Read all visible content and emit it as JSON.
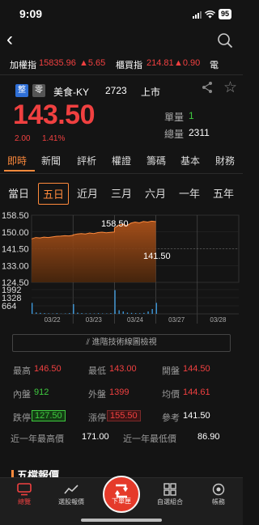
{
  "status": {
    "time": "9:09",
    "battery": "95"
  },
  "ticker": {
    "twse_label": "加權指",
    "twse_value": "15835.96",
    "twse_change": "▲5.65",
    "otc_label": "櫃買指",
    "otc_value": "214.81",
    "otc_change": "▲0.90",
    "more_label": "電"
  },
  "stock": {
    "badge1": "整",
    "badge2": "零",
    "name": "美食-KY",
    "code": "2723",
    "market": "上市",
    "price": "143.50",
    "change": "2.00",
    "change_pct": "1.41%",
    "volume_label": "單量",
    "volume_value": "1",
    "total_label": "總量",
    "total_value": "2311"
  },
  "tabs": [
    "即時",
    "新聞",
    "評析",
    "權證",
    "籌碼",
    "基本",
    "財務"
  ],
  "periods": [
    "當日",
    "五日",
    "近月",
    "三月",
    "六月",
    "一年",
    "五年"
  ],
  "colors": {
    "accent": "#ff8a3c",
    "up": "#f04040",
    "down": "#3fca3f"
  },
  "chart_data": {
    "type": "area",
    "price_ticks": [
      "158.50",
      "150.00",
      "141.50",
      "133.00",
      "124.50"
    ],
    "volume_ticks": [
      "1992",
      "1328",
      "664"
    ],
    "dates": [
      "03/22",
      "03/23",
      "03/24",
      "03/27",
      "03/28"
    ],
    "annotation_high": "158.50",
    "annotation_low": "141.50",
    "ylim": [
      124.5,
      158.5
    ]
  },
  "chart_button": "進階技術線圖檢視",
  "stats": {
    "high_label": "最高",
    "high": "146.50",
    "low_label": "最低",
    "low": "143.00",
    "open_label": "開盤",
    "open": "144.50",
    "inner_label": "內盤",
    "inner": "912",
    "outer_label": "外盤",
    "outer": "1399",
    "avg_label": "均價",
    "avg": "144.61",
    "limit_down_label": "跌停",
    "limit_down": "127.50",
    "limit_up_label": "漲停",
    "limit_up": "155.50",
    "ref_label": "參考",
    "ref": "141.50",
    "year_high_label": "近一年最高價",
    "year_high": "171.00",
    "year_low_label": "近一年最低價",
    "year_low": "86.90"
  },
  "section_title": "五檔報價",
  "bottom_nav": [
    "總覽",
    "選股報價",
    "下單匣",
    "自選組合",
    "帳務"
  ]
}
